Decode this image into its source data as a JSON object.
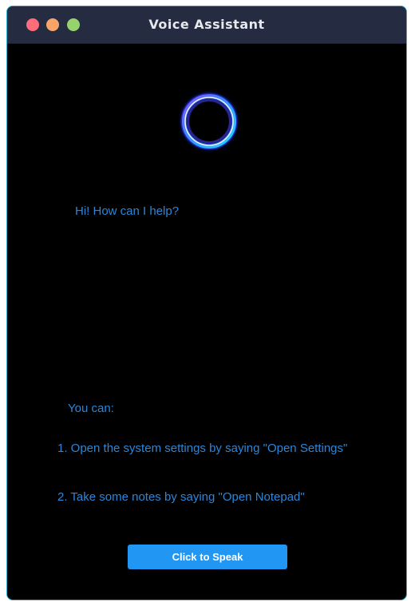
{
  "window": {
    "title": "Voice Assistant"
  },
  "assistant": {
    "greeting": "Hi! How can I help?",
    "tips_heading": "You can:",
    "tips": [
      "1. Open the system settings by saying \"Open Settings\"",
      "2. Take some notes by saying \"Open Notepad\""
    ],
    "speak_button_label": "Click to Speak"
  },
  "icons": {
    "orb": "glowing-ring-icon",
    "close": "close-dot-icon",
    "minimize": "minimize-dot-icon",
    "maximize": "maximize-dot-icon"
  },
  "colors": {
    "titlebar": "#252b40",
    "background": "#000000",
    "text": "#2b86d9",
    "button": "#2196f3",
    "close": "#fe6d79",
    "minimize": "#f9a56a",
    "maximize": "#97d36c"
  }
}
